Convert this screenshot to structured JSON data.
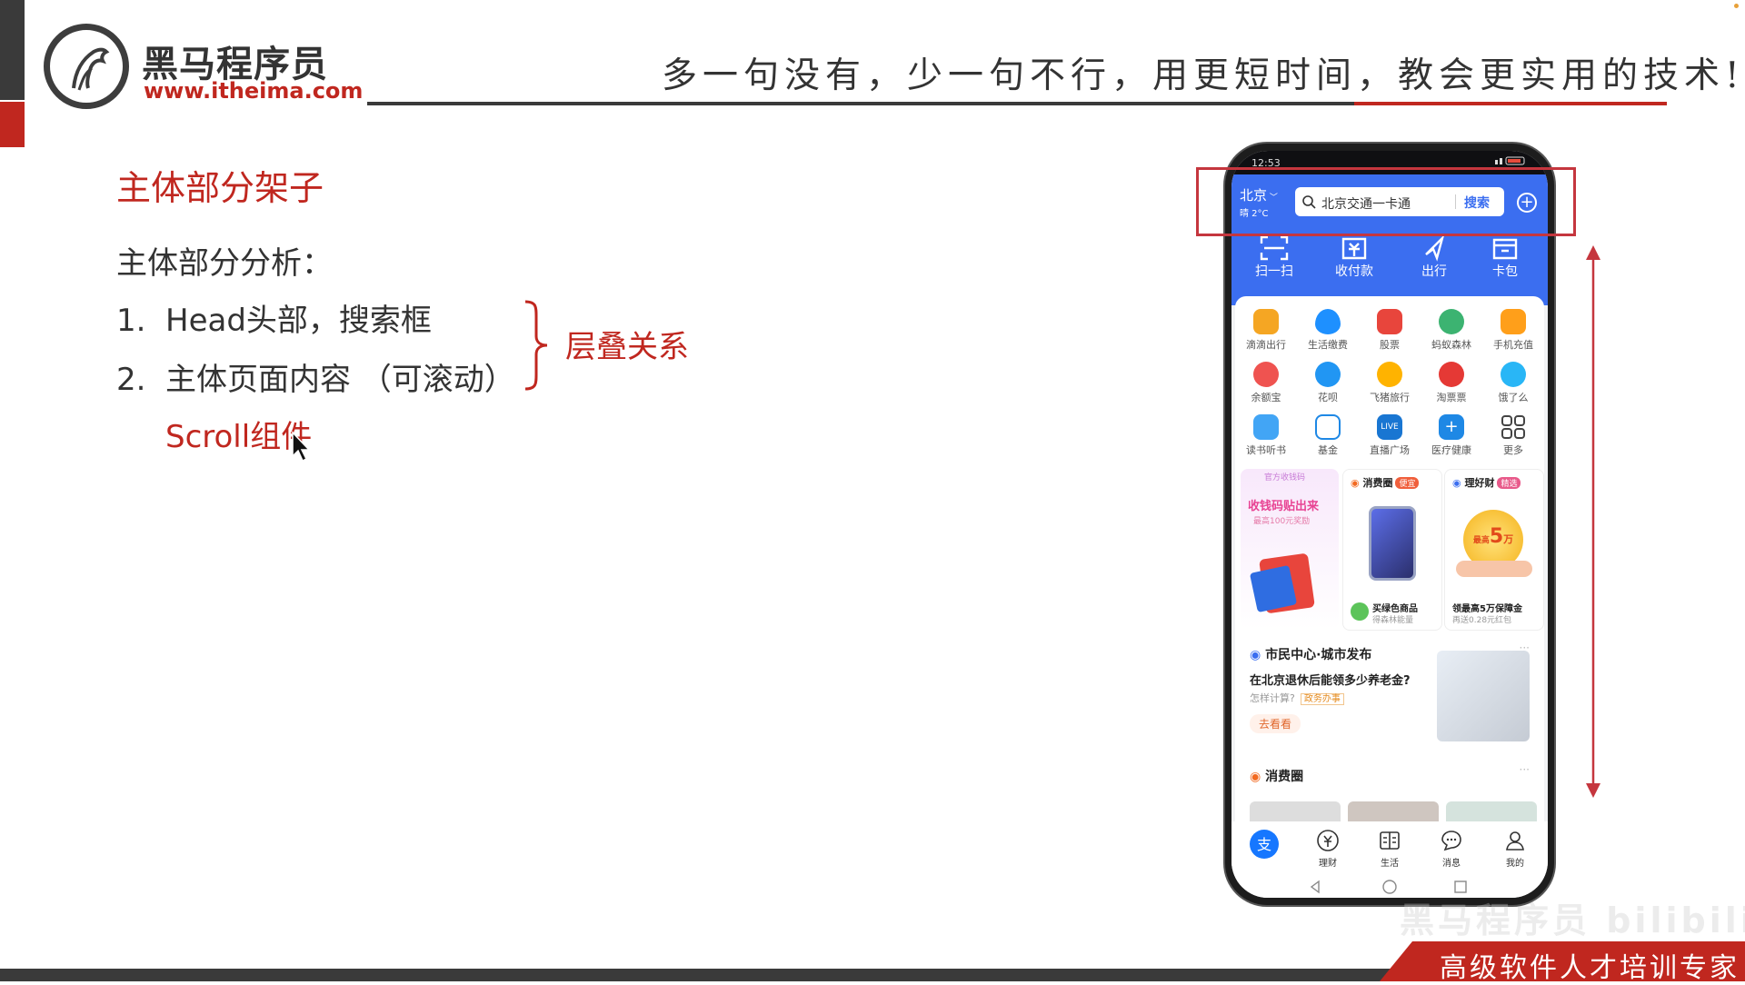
{
  "brand": {
    "name": "黑马程序员",
    "url": "www.itheima.com",
    "slogan": "多一句没有，少一句不行，用更短时间，教会更实用的技术!",
    "footer": "高级软件人才培训专家",
    "watermark": "黑马程序员 bilibili"
  },
  "slide": {
    "title": "主体部分架子",
    "analysis": "主体部分分析：",
    "items": [
      {
        "num": "1.",
        "text": "Head头部，搜索框"
      },
      {
        "num": "2.",
        "text": "主体页面内容 （可滚动）"
      }
    ],
    "scroll_note": "Scroll组件",
    "layer_note": "层叠关系"
  },
  "phone": {
    "status_time": "12:53",
    "city": "北京",
    "weather": "晴 2°C",
    "search_placeholder": "北京交通一卡通",
    "search_button": "搜索",
    "quick_actions": [
      "扫一扫",
      "收付款",
      "出行",
      "卡包"
    ],
    "grid_apps": [
      {
        "label": "滴滴出行",
        "color": "#f5a623"
      },
      {
        "label": "生活缴费",
        "color": "#1e90ff"
      },
      {
        "label": "股票",
        "color": "#e8453c"
      },
      {
        "label": "蚂蚁森林",
        "color": "#3cb371"
      },
      {
        "label": "手机充值",
        "color": "#ff9f1a"
      },
      {
        "label": "余额宝",
        "color": "#ef5350"
      },
      {
        "label": "花呗",
        "color": "#2196f3"
      },
      {
        "label": "飞猪旅行",
        "color": "#ffb300"
      },
      {
        "label": "淘票票",
        "color": "#e53935"
      },
      {
        "label": "饿了么",
        "color": "#29b6f6"
      },
      {
        "label": "读书听书",
        "color": "#42a5f5"
      },
      {
        "label": "基金",
        "color": "#1e88e5"
      },
      {
        "label": "直播广场",
        "color": "#1976d2"
      },
      {
        "label": "医疗健康",
        "color": "#1e88e5"
      },
      {
        "label": "更多",
        "color": "#444444"
      }
    ],
    "promos": {
      "p1_top": "官方收钱码",
      "p1_title": "收钱码贴出来",
      "p1_sub": "最高100元奖励",
      "p2_tag": "消费圈",
      "p2_badge": "便宜",
      "p2_label": "买绿色商品",
      "p2_sub": "得森林能量",
      "p3_tag": "理好财",
      "p3_badge": "精选",
      "p3_label": "领最高5万保障金",
      "p3_sub": "再送0.28元红包",
      "p3_coin_small": "最高",
      "p3_coin_big": "5",
      "p3_coin_unit": "万"
    },
    "news": {
      "title": "市民中心·城市发布",
      "question": "在北京退休后能领多少养老金?",
      "sub": "怎样计算?",
      "tag": "政务办事",
      "button": "去看看"
    },
    "circle_title": "消费圈",
    "tabs": [
      "理财",
      "生活",
      "消息",
      "我的"
    ],
    "colors": {
      "header_blue": "#3b6ef0",
      "highlight_red": "#c5363e"
    }
  }
}
